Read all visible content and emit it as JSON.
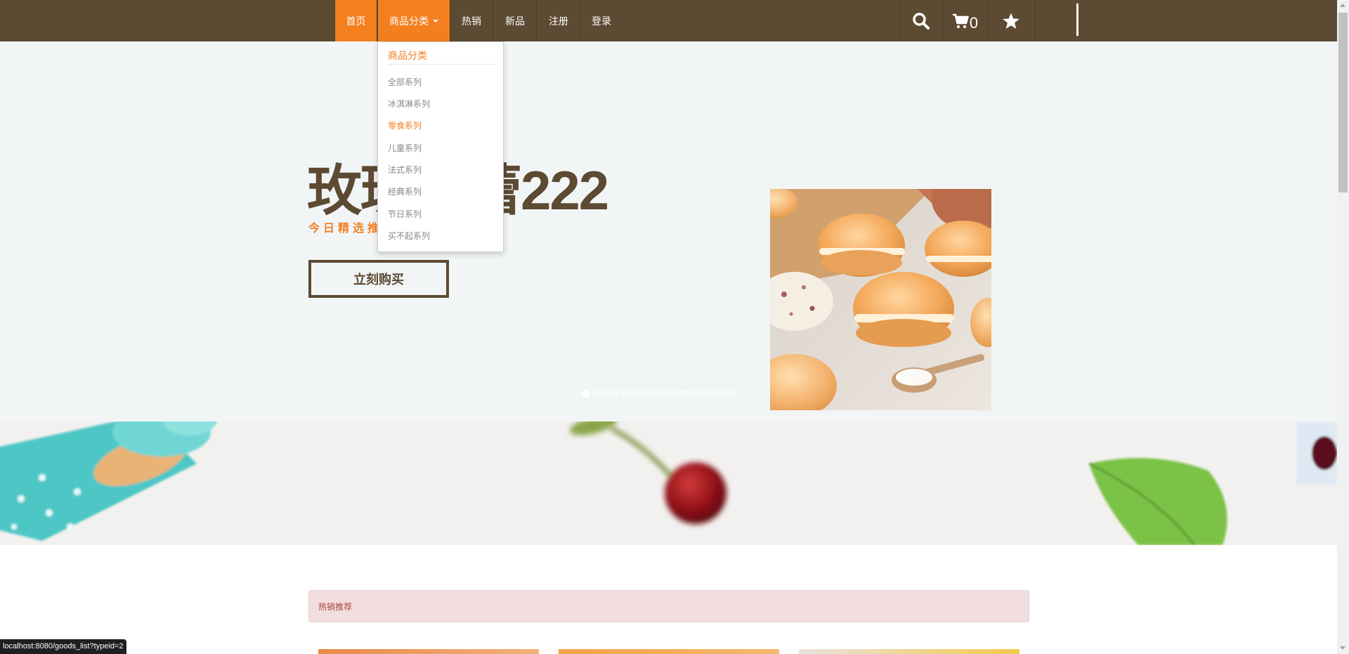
{
  "navbar": {
    "items": [
      {
        "label": "首页"
      },
      {
        "label": "商品分类"
      },
      {
        "label": "热销"
      },
      {
        "label": "新品"
      },
      {
        "label": "注册"
      },
      {
        "label": "登录"
      }
    ],
    "cart_count": "0",
    "icons": [
      "search-icon",
      "cart-icon",
      "star-icon"
    ]
  },
  "dropdown": {
    "header": "商品分类",
    "items": [
      {
        "label": "全部系列"
      },
      {
        "label": "冰淇淋系列"
      },
      {
        "label": "零食系列"
      },
      {
        "label": "儿童系列"
      },
      {
        "label": "法式系列"
      },
      {
        "label": "经典系列"
      },
      {
        "label": "节日系列"
      },
      {
        "label": "买不起系列"
      }
    ],
    "hovered": "零食系列"
  },
  "hero": {
    "title": "玫瑰芙蕾222",
    "subtitle": "今日精选推荐",
    "buy_label": "立刻购买",
    "slide_count": 16,
    "active_slide": 1
  },
  "section": {
    "title": "热销推荐"
  },
  "status_bar": {
    "url": "localhost:8080/goods_list?typeid=2"
  },
  "colors": {
    "nav_bg": "#5c4a33",
    "accent": "#f37f1f",
    "hero_bg": "#f2f5f6",
    "section_bg": "#f2dede",
    "section_text": "#a94442"
  }
}
